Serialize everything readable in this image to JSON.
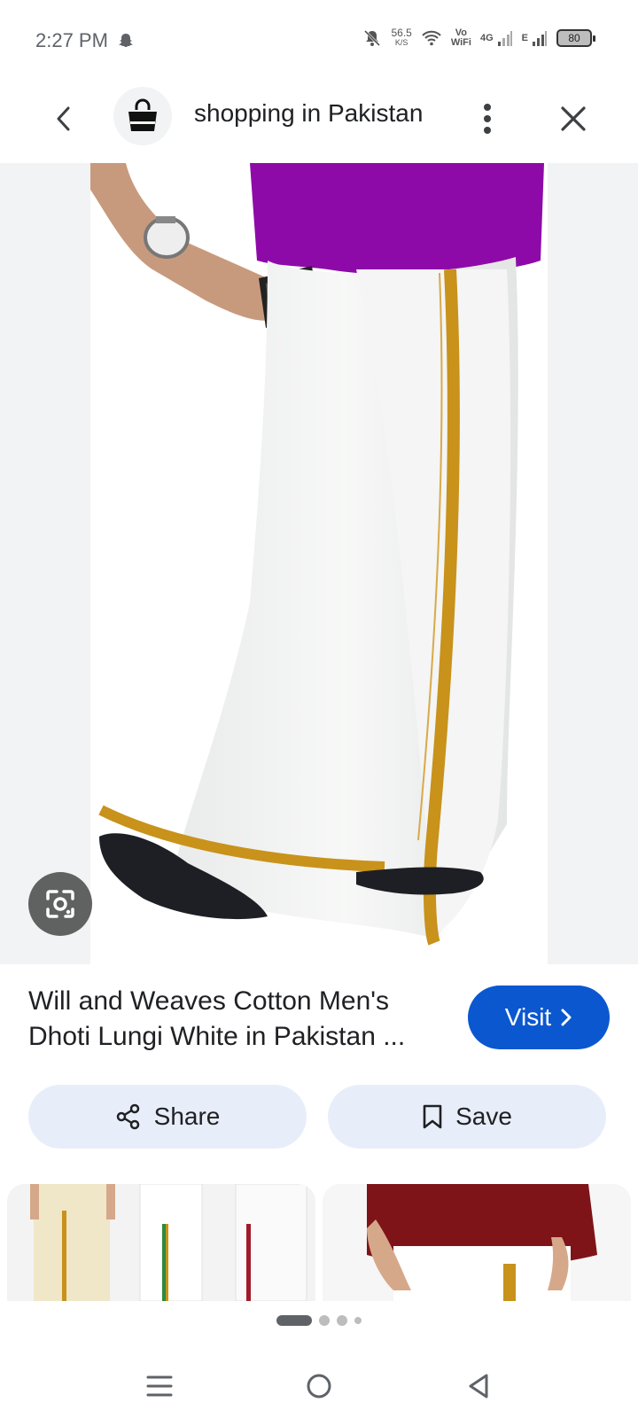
{
  "status_bar": {
    "time": "2:27 PM",
    "net_speed_value": "56.5",
    "net_speed_unit": "K/S",
    "vo_label": "Vo",
    "wifi_label": "WiFi",
    "net_4g": "4G",
    "net_e": "E",
    "battery": "80"
  },
  "top_bar": {
    "title": "shopping in Pakistan"
  },
  "result": {
    "title": "Will and Weaves Cotton Men's Dhoti Lungi White in Pakistan ...",
    "visit_label": "Visit"
  },
  "actions": {
    "share_label": "Share",
    "save_label": "Save"
  },
  "pagination": {
    "total": 4,
    "active": 1
  },
  "colors": {
    "accent": "#0b57d0",
    "action_bg": "#e8eef9",
    "shirt_purple": "#8e0aa8",
    "border_gold": "#c8921b"
  },
  "icons": {
    "back": "chevron-left-icon",
    "avatar": "shopping-bag-icon",
    "more": "more-vert-icon",
    "close": "close-icon",
    "lens": "google-lens-icon",
    "share": "share-icon",
    "save": "bookmark-icon",
    "nav_menu": "menu-icon",
    "nav_home": "home-circle-icon",
    "nav_back": "triangle-back-icon"
  }
}
